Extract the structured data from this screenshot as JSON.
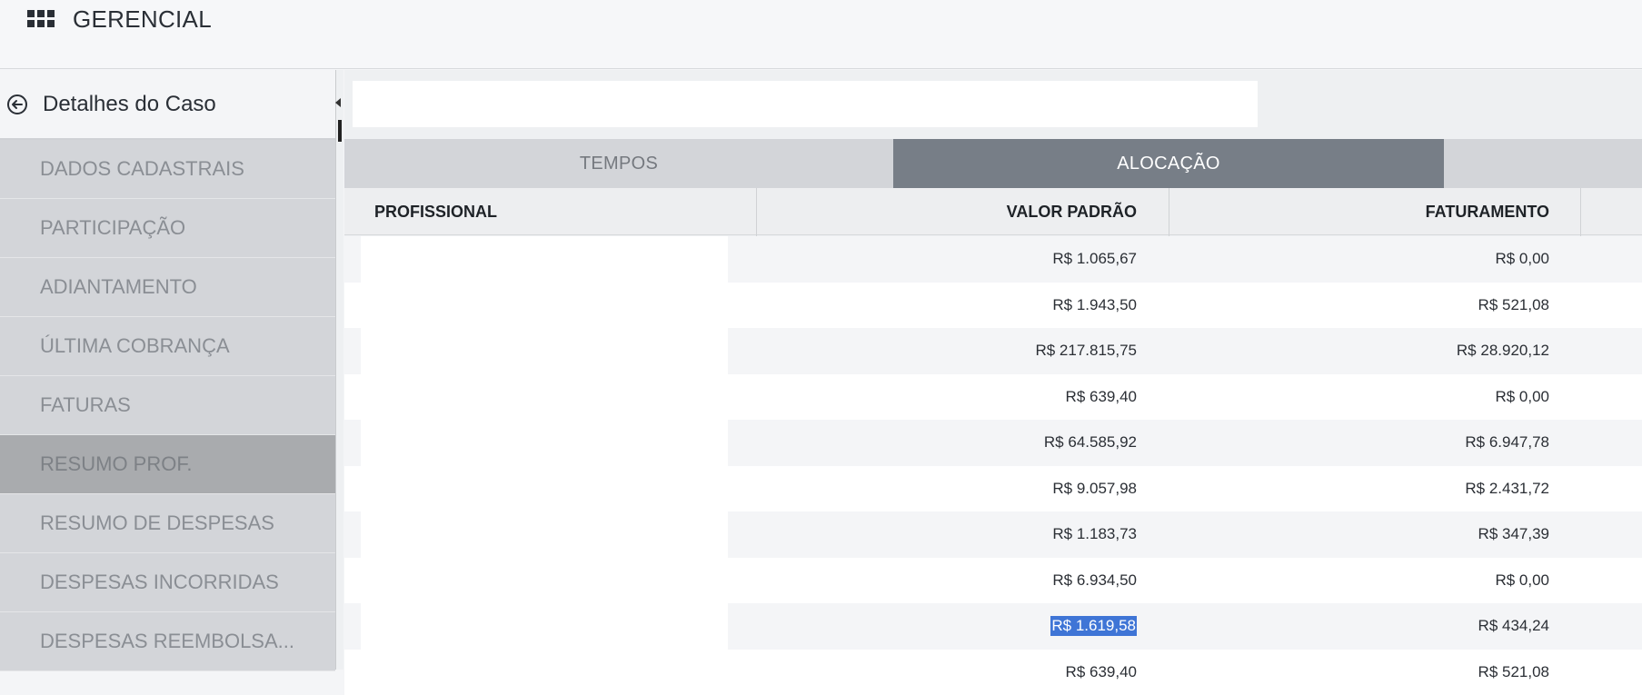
{
  "header": {
    "title": "GERENCIAL"
  },
  "sidebar": {
    "title": "Detalhes do Caso",
    "items": [
      {
        "label": "DADOS CADASTRAIS"
      },
      {
        "label": "PARTICIPAÇÃO"
      },
      {
        "label": "ADIANTAMENTO"
      },
      {
        "label": "ÚLTIMA COBRANÇA"
      },
      {
        "label": "FATURAS"
      },
      {
        "label": "RESUMO PROF.",
        "active": true
      },
      {
        "label": "RESUMO DE DESPESAS"
      },
      {
        "label": "DESPESAS INCORRIDAS"
      },
      {
        "label": "DESPESAS REEMBOLSA..."
      }
    ]
  },
  "search": {
    "value": "",
    "placeholder": ""
  },
  "tabs": [
    {
      "label": "TEMPOS",
      "active": false
    },
    {
      "label": "ALOCAÇÃO",
      "active": true
    }
  ],
  "table": {
    "columns": [
      "PROFISSIONAL",
      "VALOR PADRÃO",
      "FATURAMENTO"
    ],
    "rows": [
      {
        "profissional": "",
        "valor_padrao": "R$ 1.065,67",
        "faturamento": "R$ 0,00"
      },
      {
        "profissional": "",
        "valor_padrao": "R$ 1.943,50",
        "faturamento": "R$ 521,08"
      },
      {
        "profissional": "",
        "valor_padrao": "R$ 217.815,75",
        "faturamento": "R$ 28.920,12"
      },
      {
        "profissional": "",
        "valor_padrao": "R$ 639,40",
        "faturamento": "R$ 0,00"
      },
      {
        "profissional": "",
        "valor_padrao": "R$ 64.585,92",
        "faturamento": "R$ 6.947,78"
      },
      {
        "profissional": "",
        "valor_padrao": "R$ 9.057,98",
        "faturamento": "R$ 2.431,72"
      },
      {
        "profissional": "",
        "valor_padrao": "R$ 1.183,73",
        "faturamento": "R$ 347,39"
      },
      {
        "profissional": "",
        "valor_padrao": "R$ 6.934,50",
        "faturamento": "R$ 0,00"
      },
      {
        "profissional": "",
        "valor_padrao": "R$ 1.619,58",
        "faturamento": "R$ 434,24",
        "selected_text": true
      },
      {
        "profissional": "",
        "valor_padrao": "R$ 639,40",
        "faturamento": "R$ 521,08"
      }
    ]
  },
  "icons": {
    "apps": "grid-apps-icon",
    "back": "arrow-left-circle-icon"
  },
  "colors": {
    "active_tab": "#777e87",
    "active_menu": "#a9abae",
    "selection": "#3f75d6"
  }
}
